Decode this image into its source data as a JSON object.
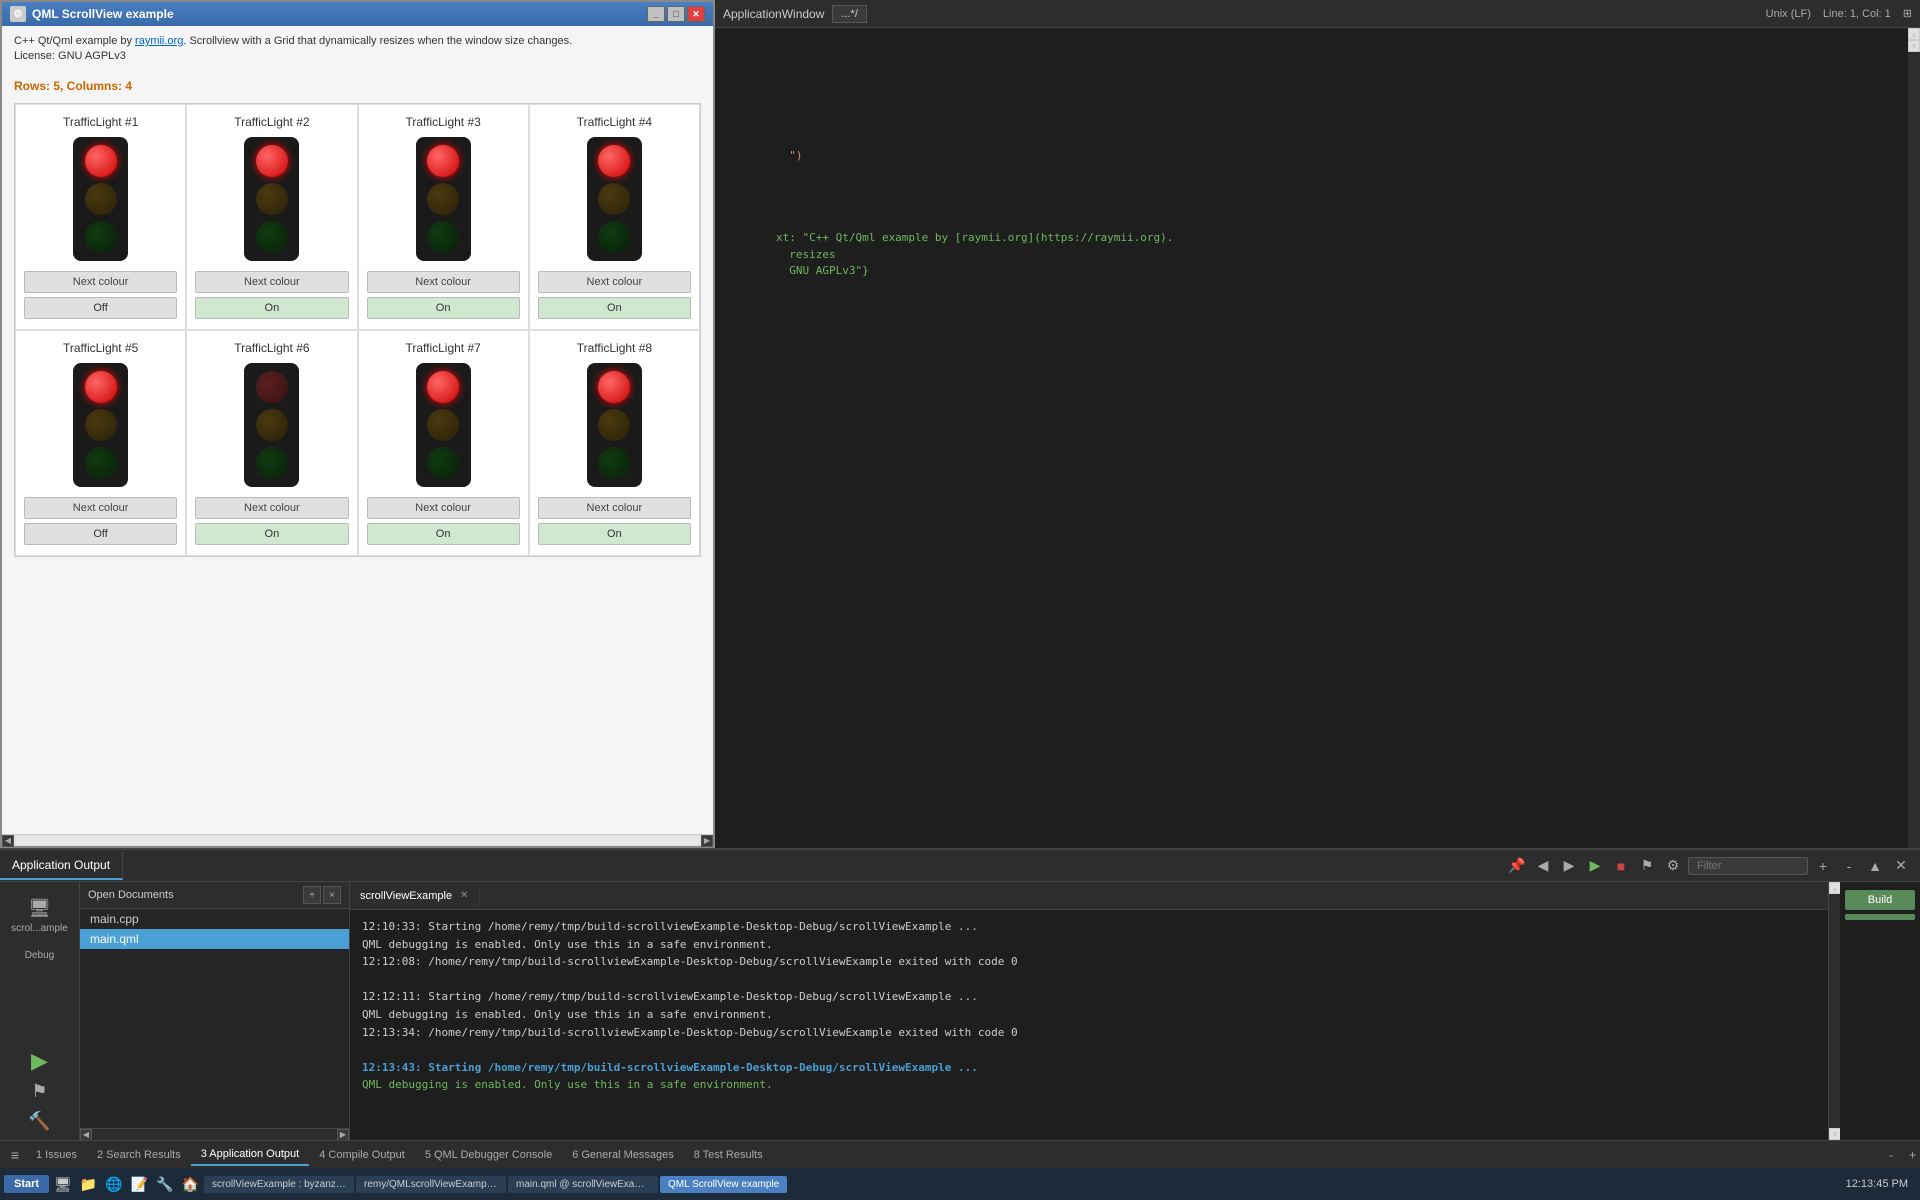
{
  "app_window": {
    "title": "QML ScrollView example",
    "description_prefix": "C++ Qt/Qml example by ",
    "link_text": "raymii.org",
    "description_suffix": ". Scrollview with a Grid that dynamically resizes when the window size changes.",
    "license": "License: GNU AGPLv3",
    "rows_label": "Rows: 5, Columns: ",
    "rows_value": "4",
    "traffic_lights": [
      {
        "id": 1,
        "title": "TrafficLight #1",
        "active_bulb": "red",
        "next_btn": "Next colour",
        "toggle": "Off"
      },
      {
        "id": 2,
        "title": "TrafficLight #2",
        "active_bulb": "red",
        "next_btn": "Next colour",
        "toggle": "On"
      },
      {
        "id": 3,
        "title": "TrafficLight #3",
        "active_bulb": "red",
        "next_btn": "Next colour",
        "toggle": "On"
      },
      {
        "id": 4,
        "title": "TrafficLight #4",
        "active_bulb": "red",
        "next_btn": "Next colour",
        "toggle": "On"
      },
      {
        "id": 5,
        "title": "TrafficLight #5",
        "active_bulb": "red",
        "next_btn": "Next colour",
        "toggle": "Off"
      },
      {
        "id": 6,
        "title": "TrafficLight #6",
        "active_bulb": "none",
        "next_btn": "Next colour",
        "toggle": "On"
      },
      {
        "id": 7,
        "title": "TrafficLight #7",
        "active_bulb": "red",
        "next_btn": "Next colour",
        "toggle": "On"
      },
      {
        "id": 8,
        "title": "TrafficLight #8",
        "active_bulb": "red",
        "next_btn": "Next colour",
        "toggle": "On"
      }
    ]
  },
  "editor": {
    "filename": "ApplicationWindow",
    "encoding": "Unix (LF)",
    "position": "Line: 1, Col: 1",
    "code_fragment": "\")",
    "code_text_block": "xt: \"C++ Qt/Qml example by [raymii.org](https://raymii.org).\n  resizes\n  GNU AGPLv3\"}"
  },
  "bottom_panel": {
    "header_label": "Application Output",
    "filter_placeholder": "Filter",
    "tabs": [
      {
        "label": "scrollViewExample",
        "closeable": true,
        "active": true
      }
    ],
    "log_lines": [
      {
        "text": "12:10:33: Starting /home/remy/tmp/build-scrollviewExample-Desktop-Debug/scrollViewExample ...",
        "style": "normal"
      },
      {
        "text": "QML debugging is enabled. Only use this in a safe environment.",
        "style": "normal"
      },
      {
        "text": "12:12:08: /home/remy/tmp/build-scrollviewExample-Desktop-Debug/scrollViewExample exited with code 0",
        "style": "normal"
      },
      {
        "text": "",
        "style": "normal"
      },
      {
        "text": "12:12:11: Starting /home/remy/tmp/build-scrollviewExample-Desktop-Debug/scrollViewExample ...",
        "style": "normal"
      },
      {
        "text": "QML debugging is enabled. Only use this in a safe environment.",
        "style": "normal"
      },
      {
        "text": "12:13:34: /home/remy/tmp/build-scrollviewExample-Desktop-Debug/scrollViewExample exited with code 0",
        "style": "normal"
      },
      {
        "text": "",
        "style": "normal"
      },
      {
        "text": "12:13:43: Starting /home/remy/tmp/build-scrollviewExample-Desktop-Debug/scrollViewExample ...",
        "style": "bold-blue"
      },
      {
        "text": "QML debugging is enabled. Only use this in a safe environment.",
        "style": "green"
      }
    ]
  },
  "open_documents": {
    "title": "Open Documents",
    "files": [
      {
        "name": "main.cpp",
        "active": false
      },
      {
        "name": "main.qml",
        "active": true
      }
    ]
  },
  "footer_tabs": [
    {
      "label": "1  Issues"
    },
    {
      "label": "2  Search Results"
    },
    {
      "label": "3  Application Output",
      "active": true
    },
    {
      "label": "4  Compile Output"
    },
    {
      "label": "5  QML Debugger Console"
    },
    {
      "label": "6  General Messages"
    },
    {
      "label": "8  Test Results"
    }
  ],
  "sidebar": {
    "label": "scrol...ample",
    "mode": "Debug"
  },
  "taskbar": {
    "start": "Start",
    "items": [
      "scrollViewExample : byzanz-record...",
      "remy/QMLscrollViewExample - QM...",
      "main.qml @ scrollViewExample [m...",
      "QML ScrollView example"
    ],
    "time": "12:13:45 PM"
  },
  "build_btn": "Build",
  "toolbar": {
    "plus": "+",
    "minus": "-"
  }
}
